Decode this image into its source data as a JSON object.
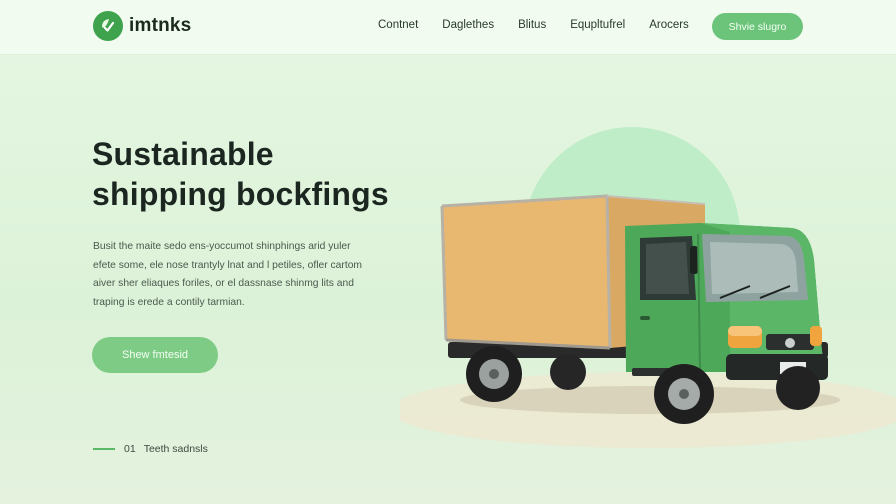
{
  "header": {
    "brand": "imtnks",
    "nav": [
      {
        "label": "Contnet"
      },
      {
        "label": "Daglethes"
      },
      {
        "label": "Blitus"
      },
      {
        "label": "Equpltufrel"
      },
      {
        "label": "Arocers"
      }
    ],
    "cta_label": "Shvie slugro"
  },
  "hero": {
    "title_lines": [
      "Sustainable",
      "shipping bockfings"
    ],
    "description_lines": [
      "Busit the maite sedo ens-yoccumot shinphings arid yuler",
      "efete some, ele nose trantyly lnat and l petiles, ofler cartom",
      "aiver sher eliaques foriles, or el dassnase shinmg lits and",
      "traping is erede a contily tarmian."
    ],
    "cta_label": "Shew fmtesid"
  },
  "feature_note": {
    "number": "01",
    "label": "Teeth sadnsls"
  },
  "colors": {
    "accent": "#6cc47a",
    "brand_green": "#3fa34d",
    "background": "#ddf3d9",
    "truck_cab": "#4ea85a",
    "cargo_box": "#e6b672"
  },
  "icons": {
    "logo": "leaf-check-logo"
  },
  "illustration": {
    "subject": "green delivery truck with tan cargo box"
  }
}
